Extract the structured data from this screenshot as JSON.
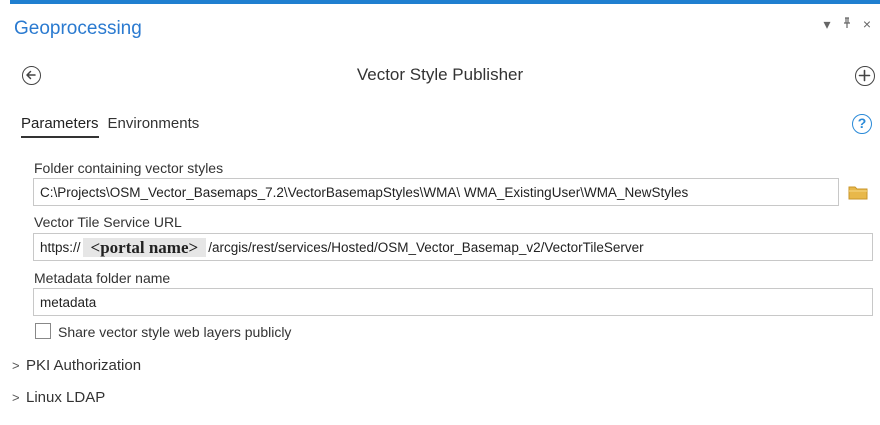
{
  "panel": {
    "title": "Geoprocessing",
    "controls": {
      "menu": "▾",
      "pin": "ᵖ",
      "close": "×"
    }
  },
  "tool": {
    "title": "Vector Style Publisher"
  },
  "tabs": [
    {
      "label": "Parameters",
      "active": true
    },
    {
      "label": "Environments",
      "active": false
    }
  ],
  "params": {
    "folder": {
      "label": "Folder containing vector styles",
      "value": "C:\\Projects\\OSM_Vector_Basemaps_7.2\\VectorBasemapStyles\\WMA\\ WMA_ExistingUser\\WMA_NewStyles"
    },
    "url": {
      "label": "Vector Tile Service URL",
      "prefix": "https://",
      "portal": "<portal name>",
      "suffix": "/arcgis/rest/services/Hosted/OSM_Vector_Basemap_v2/VectorTileServer"
    },
    "metadata": {
      "label": "Metadata folder name",
      "value": "metadata"
    },
    "share": {
      "label": "Share vector style web layers publicly",
      "checked": false
    }
  },
  "sections": [
    {
      "label": "PKI Authorization",
      "chevron": ">"
    },
    {
      "label": "Linux LDAP",
      "chevron": ">"
    }
  ],
  "colors": {
    "accent": "#2a7ad0",
    "topbar": "#1f7fd0",
    "folder": "#e8b84a",
    "help": "#2a8ad8"
  },
  "icons": [
    "back-arrow-icon",
    "add-icon",
    "help-icon",
    "folder-icon",
    "chevron-right-icon"
  ]
}
